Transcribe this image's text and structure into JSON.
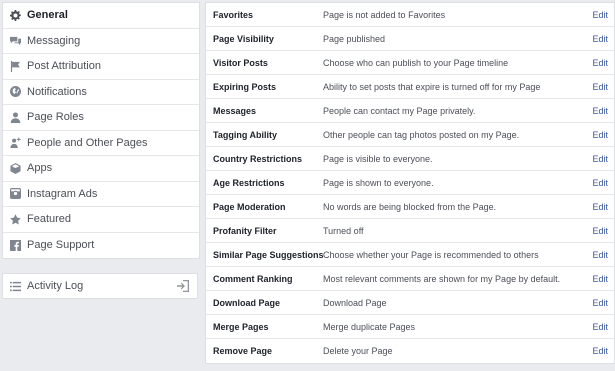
{
  "sidebar": {
    "items": [
      {
        "label": "General",
        "icon": "gear-icon"
      },
      {
        "label": "Messaging",
        "icon": "messages-icon"
      },
      {
        "label": "Post Attribution",
        "icon": "flag-icon"
      },
      {
        "label": "Notifications",
        "icon": "globe-icon"
      },
      {
        "label": "Page Roles",
        "icon": "person-icon"
      },
      {
        "label": "People and Other Pages",
        "icon": "people-icon"
      },
      {
        "label": "Apps",
        "icon": "cube-icon"
      },
      {
        "label": "Instagram Ads",
        "icon": "camera-icon"
      },
      {
        "label": "Featured",
        "icon": "star-icon"
      },
      {
        "label": "Page Support",
        "icon": "facebook-icon"
      }
    ]
  },
  "activity": {
    "label": "Activity Log",
    "icon": "list-icon",
    "action_icon": "enter-icon"
  },
  "settings": {
    "edit_label": "Edit",
    "rows": [
      {
        "label": "Favorites",
        "value": "Page is not added to Favorites"
      },
      {
        "label": "Page Visibility",
        "value": "Page published"
      },
      {
        "label": "Visitor Posts",
        "value": "Choose who can publish to your Page timeline"
      },
      {
        "label": "Expiring Posts",
        "value": "Ability to set posts that expire is turned off for my Page"
      },
      {
        "label": "Messages",
        "value": "People can contact my Page privately."
      },
      {
        "label": "Tagging Ability",
        "value": "Other people can tag photos posted on my Page."
      },
      {
        "label": "Country Restrictions",
        "value": "Page is visible to everyone."
      },
      {
        "label": "Age Restrictions",
        "value": "Page is shown to everyone."
      },
      {
        "label": "Page Moderation",
        "value": "No words are being blocked from the Page."
      },
      {
        "label": "Profanity Filter",
        "value": "Turned off"
      },
      {
        "label": "Similar Page Suggestions",
        "value": "Choose whether your Page is recommended to others"
      },
      {
        "label": "Comment Ranking",
        "value": "Most relevant comments are shown for my Page by default."
      },
      {
        "label": "Download Page",
        "value": "Download Page"
      },
      {
        "label": "Merge Pages",
        "value": "Merge duplicate Pages"
      },
      {
        "label": "Remove Page",
        "value": "Delete your Page"
      }
    ]
  }
}
